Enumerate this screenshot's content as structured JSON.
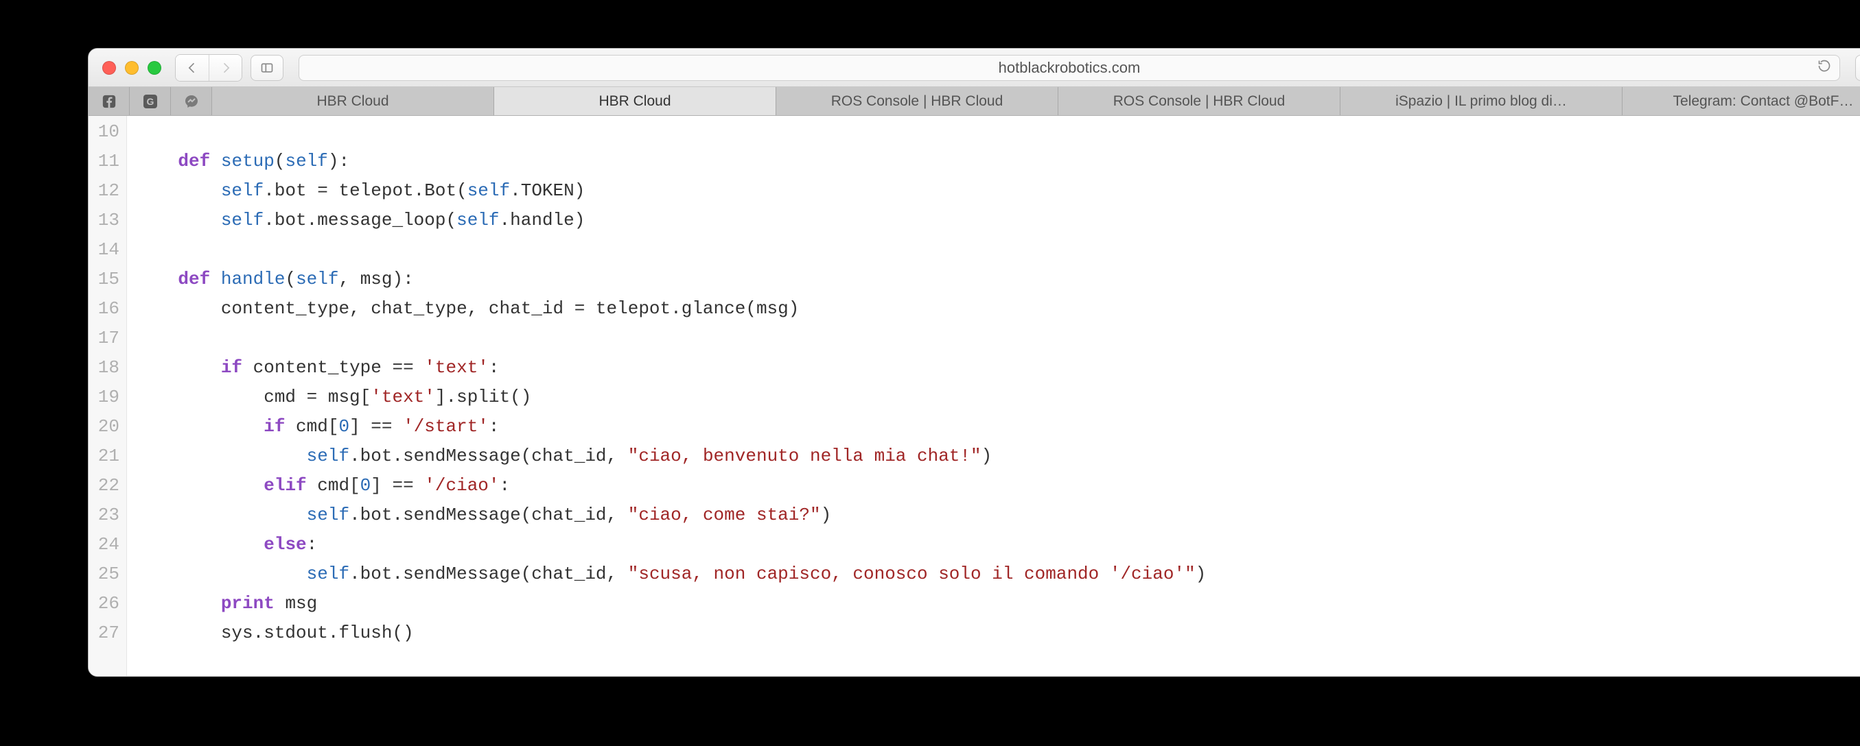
{
  "address_bar": {
    "domain": "hotblackrobotics.com"
  },
  "tabs": {
    "pinned": [
      "facebook-icon",
      "google-icon",
      "messenger-icon"
    ],
    "items": [
      {
        "label": "HBR Cloud"
      },
      {
        "label": "HBR Cloud"
      },
      {
        "label": "ROS Console | HBR Cloud"
      },
      {
        "label": "ROS Console | HBR Cloud"
      },
      {
        "label": "iSpazio | IL primo blog di…"
      },
      {
        "label": "Telegram: Contact @BotF…"
      }
    ],
    "active_index": 1
  },
  "editor": {
    "first_line_number": 10,
    "lines": [
      {
        "tokens": []
      },
      {
        "tokens": [
          {
            "t": "    ",
            "c": "pn"
          },
          {
            "t": "def",
            "c": "kw"
          },
          {
            "t": " ",
            "c": "pn"
          },
          {
            "t": "setup",
            "c": "fn"
          },
          {
            "t": "(",
            "c": "pn"
          },
          {
            "t": "self",
            "c": "slf"
          },
          {
            "t": "):",
            "c": "pn"
          }
        ]
      },
      {
        "tokens": [
          {
            "t": "        ",
            "c": "pn"
          },
          {
            "t": "self",
            "c": "slf"
          },
          {
            "t": ".bot = telepot.Bot(",
            "c": "pn"
          },
          {
            "t": "self",
            "c": "slf"
          },
          {
            "t": ".TOKEN)",
            "c": "pn"
          }
        ]
      },
      {
        "tokens": [
          {
            "t": "        ",
            "c": "pn"
          },
          {
            "t": "self",
            "c": "slf"
          },
          {
            "t": ".bot.message_loop(",
            "c": "pn"
          },
          {
            "t": "self",
            "c": "slf"
          },
          {
            "t": ".handle)",
            "c": "pn"
          }
        ]
      },
      {
        "tokens": []
      },
      {
        "tokens": [
          {
            "t": "    ",
            "c": "pn"
          },
          {
            "t": "def",
            "c": "kw"
          },
          {
            "t": " ",
            "c": "pn"
          },
          {
            "t": "handle",
            "c": "fn"
          },
          {
            "t": "(",
            "c": "pn"
          },
          {
            "t": "self",
            "c": "slf"
          },
          {
            "t": ", msg):",
            "c": "pn"
          }
        ]
      },
      {
        "tokens": [
          {
            "t": "        content_type, chat_type, chat_id = telepot.glance(msg)",
            "c": "pn"
          }
        ]
      },
      {
        "tokens": []
      },
      {
        "tokens": [
          {
            "t": "        ",
            "c": "pn"
          },
          {
            "t": "if",
            "c": "kw"
          },
          {
            "t": " content_type == ",
            "c": "pn"
          },
          {
            "t": "'text'",
            "c": "str"
          },
          {
            "t": ":",
            "c": "pn"
          }
        ]
      },
      {
        "tokens": [
          {
            "t": "            cmd = msg[",
            "c": "pn"
          },
          {
            "t": "'text'",
            "c": "str"
          },
          {
            "t": "].split()",
            "c": "pn"
          }
        ]
      },
      {
        "tokens": [
          {
            "t": "            ",
            "c": "pn"
          },
          {
            "t": "if",
            "c": "kw"
          },
          {
            "t": " cmd[",
            "c": "pn"
          },
          {
            "t": "0",
            "c": "num"
          },
          {
            "t": "] == ",
            "c": "pn"
          },
          {
            "t": "'/start'",
            "c": "str"
          },
          {
            "t": ":",
            "c": "pn"
          }
        ]
      },
      {
        "tokens": [
          {
            "t": "                ",
            "c": "pn"
          },
          {
            "t": "self",
            "c": "slf"
          },
          {
            "t": ".bot.sendMessage(chat_id, ",
            "c": "pn"
          },
          {
            "t": "\"ciao, benvenuto nella mia chat!\"",
            "c": "str"
          },
          {
            "t": ")",
            "c": "pn"
          }
        ]
      },
      {
        "tokens": [
          {
            "t": "            ",
            "c": "pn"
          },
          {
            "t": "elif",
            "c": "kw"
          },
          {
            "t": " cmd[",
            "c": "pn"
          },
          {
            "t": "0",
            "c": "num"
          },
          {
            "t": "] == ",
            "c": "pn"
          },
          {
            "t": "'/ciao'",
            "c": "str"
          },
          {
            "t": ":",
            "c": "pn"
          }
        ]
      },
      {
        "tokens": [
          {
            "t": "                ",
            "c": "pn"
          },
          {
            "t": "self",
            "c": "slf"
          },
          {
            "t": ".bot.sendMessage(chat_id, ",
            "c": "pn"
          },
          {
            "t": "\"ciao, come stai?\"",
            "c": "str"
          },
          {
            "t": ")",
            "c": "pn"
          }
        ]
      },
      {
        "tokens": [
          {
            "t": "            ",
            "c": "pn"
          },
          {
            "t": "else",
            "c": "kw"
          },
          {
            "t": ":",
            "c": "pn"
          }
        ]
      },
      {
        "tokens": [
          {
            "t": "                ",
            "c": "pn"
          },
          {
            "t": "self",
            "c": "slf"
          },
          {
            "t": ".bot.sendMessage(chat_id, ",
            "c": "pn"
          },
          {
            "t": "\"scusa, non capisco, conosco solo il comando '/ciao'\"",
            "c": "str"
          },
          {
            "t": ")",
            "c": "pn"
          }
        ]
      },
      {
        "tokens": [
          {
            "t": "        ",
            "c": "pn"
          },
          {
            "t": "print",
            "c": "kw"
          },
          {
            "t": " msg",
            "c": "pn"
          }
        ]
      },
      {
        "tokens": [
          {
            "t": "        sys.stdout.flush()",
            "c": "pn"
          }
        ]
      }
    ]
  }
}
